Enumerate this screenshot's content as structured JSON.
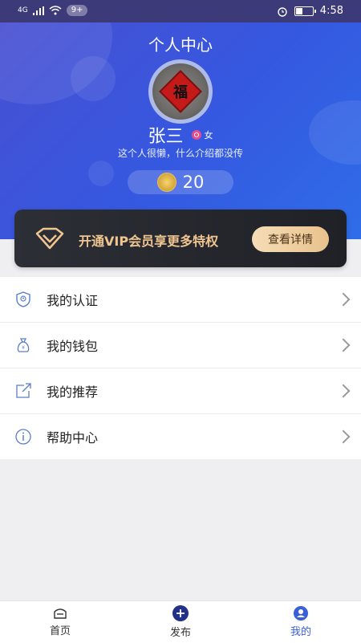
{
  "status_bar": {
    "network": "4G",
    "notifications": "9+",
    "time": "4:58"
  },
  "header": {
    "title": "个人中心"
  },
  "profile": {
    "avatar_text": "福",
    "name": "张三",
    "gender": "女",
    "bio": "这个人很懒，什么介绍都没传",
    "coins": "20"
  },
  "vip": {
    "text": "开通VIP会员享更多特权",
    "button": "查看详情"
  },
  "menu": {
    "items": [
      {
        "label": "我的认证",
        "icon": "shield-icon"
      },
      {
        "label": "我的钱包",
        "icon": "money-bag-icon"
      },
      {
        "label": "我的推荐",
        "icon": "share-icon"
      },
      {
        "label": "帮助中心",
        "icon": "info-icon"
      }
    ]
  },
  "tabs": [
    {
      "label": "首页",
      "icon": "home-icon"
    },
    {
      "label": "发布",
      "icon": "plus-icon"
    },
    {
      "label": "我的",
      "icon": "user-icon"
    }
  ],
  "colors": {
    "accent": "#3a5fd9",
    "vip_text": "#f0c590",
    "header_start": "#4a4fd0",
    "header_end": "#2f6de8"
  }
}
